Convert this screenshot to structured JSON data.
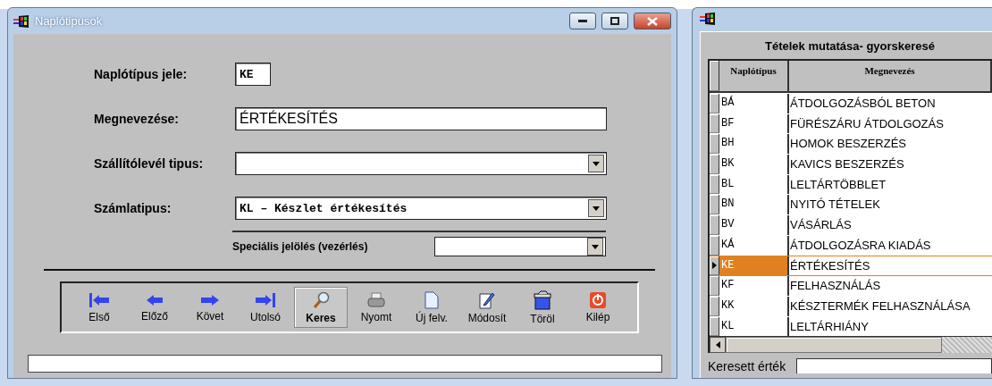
{
  "main_window": {
    "title": "Naplótipusok",
    "fields": [
      {
        "kind": "text",
        "label": "Naplótípus jele:",
        "value": "KE",
        "mono": true,
        "short": true
      },
      {
        "kind": "text",
        "label": "Megnevezése:",
        "value": "ÉRTÉKESÍTÉS",
        "mono": false,
        "short": false
      },
      {
        "kind": "combo",
        "label": "Szállítólevél tipus:",
        "short": false
      },
      {
        "kind": "combo",
        "label": "Számlatipus:",
        "value": "KL – Készlet értékesítés",
        "mono": true,
        "short": false
      }
    ],
    "special": {
      "label": "Speciális jelölés (vezérlés)"
    },
    "toolbar": [
      {
        "kind": "first",
        "label": "Első",
        "selected": false
      },
      {
        "kind": "prev",
        "label": "Előző",
        "selected": false
      },
      {
        "kind": "next",
        "label": "Követ",
        "selected": false
      },
      {
        "kind": "last",
        "label": "Utolsó",
        "selected": false
      },
      {
        "kind": "search",
        "label": "Keres",
        "selected": true
      },
      {
        "kind": "print",
        "label": "Nyomt",
        "selected": false
      },
      {
        "kind": "new",
        "label": "Új felv.",
        "selected": false
      },
      {
        "kind": "edit",
        "label": "Módosít",
        "selected": false
      },
      {
        "kind": "delete",
        "label": "Töröl",
        "selected": false
      },
      {
        "kind": "exit",
        "label": "Kilép",
        "selected": false
      }
    ]
  },
  "lookup_window": {
    "heading": "Tételek mutatása- gyorskeresé",
    "table": {
      "columns": [
        "Naplótípus",
        "Megnevezés"
      ],
      "rows": [
        {
          "code": "BÁ",
          "name": "ÁTDOLGOZÁSBÓL BETON",
          "selected": false
        },
        {
          "code": "BF",
          "name": "FÜRÉSZÁRU ÁTDOLGOZÁS",
          "selected": false
        },
        {
          "code": "BH",
          "name": "HOMOK BESZERZÉS",
          "selected": false
        },
        {
          "code": "BK",
          "name": "KAVICS BESZERZÉS",
          "selected": false
        },
        {
          "code": "BL",
          "name": "LELTÁRTÖBBLET",
          "selected": false
        },
        {
          "code": "BN",
          "name": "NYITÓ TÉTELEK",
          "selected": false
        },
        {
          "code": "BV",
          "name": "VÁSÁRLÁS",
          "selected": false
        },
        {
          "code": "KÁ",
          "name": "ÁTDOLGOZÁSRA KIADÁS",
          "selected": false
        },
        {
          "code": "KE",
          "name": "ÉRTÉKESÍTÉS",
          "selected": true
        },
        {
          "code": "KF",
          "name": "FELHASZNÁLÁS",
          "selected": false
        },
        {
          "code": "KK",
          "name": "KÉSZTERMÉK FELHASZNÁLÁSA",
          "selected": false
        },
        {
          "code": "KL",
          "name": "LELTÁRHIÁNY",
          "selected": false
        }
      ]
    },
    "search_label": "Keresett érték"
  }
}
